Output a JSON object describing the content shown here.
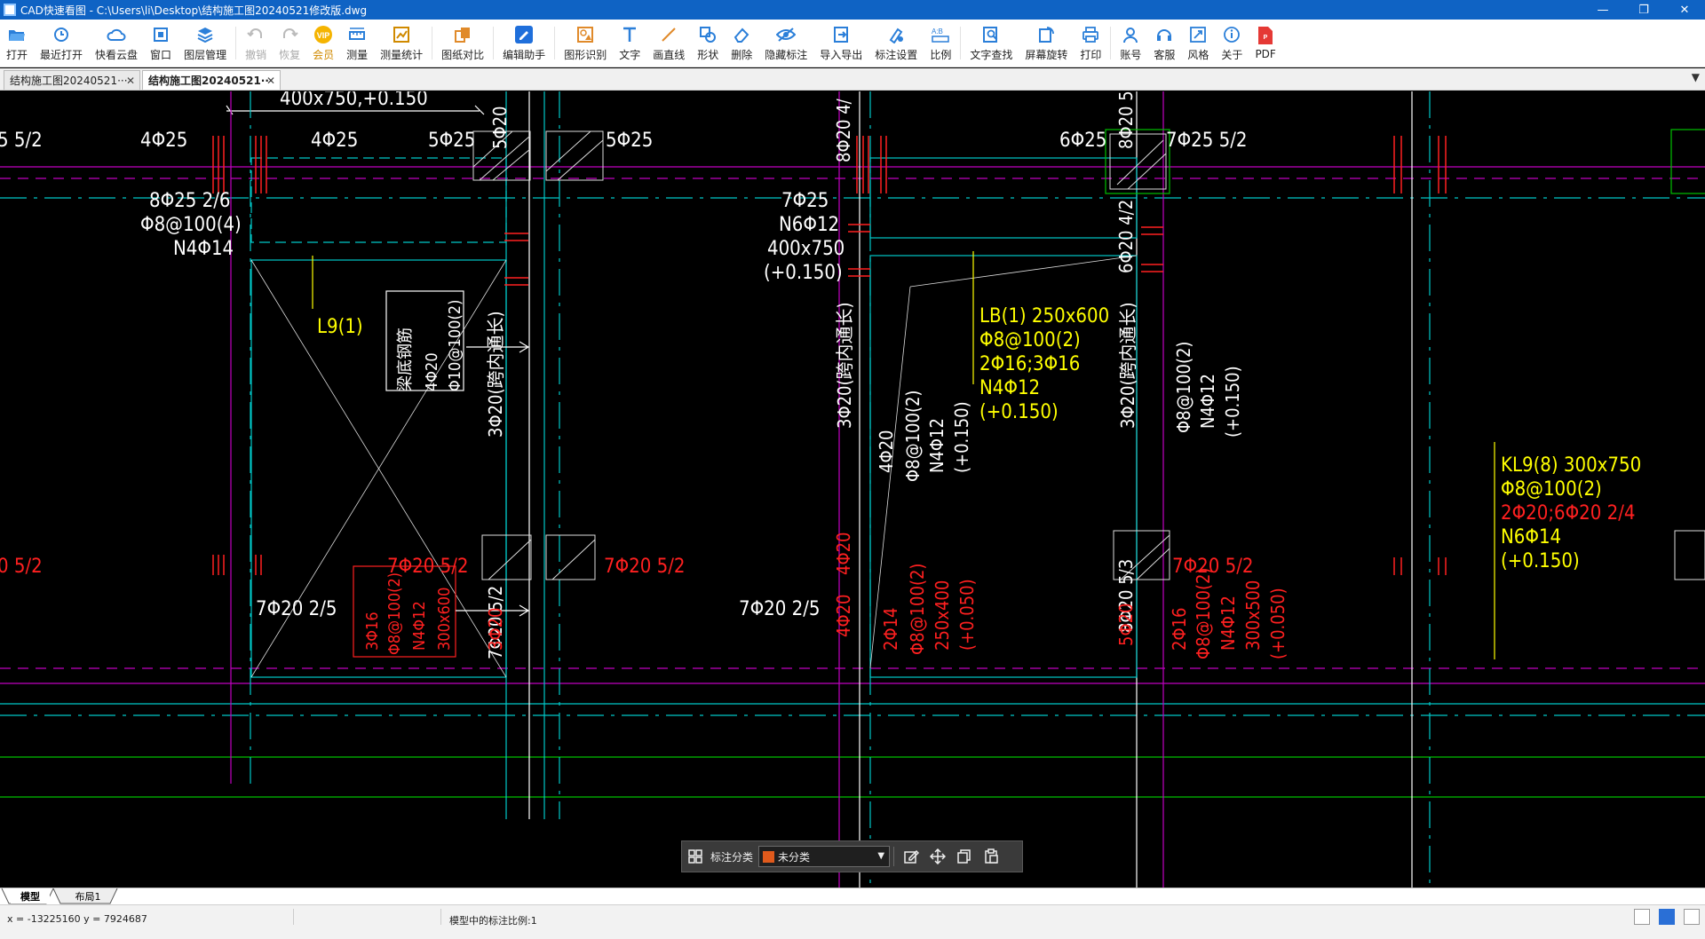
{
  "window": {
    "title": "CAD快速看图 - C:\\Users\\li\\Desktop\\结构施工图20240521修改版.dwg",
    "controls": [
      "—",
      "❐",
      "✕"
    ]
  },
  "toolbar": {
    "items": [
      {
        "label": "打开",
        "icon": "folder-open-icon"
      },
      {
        "label": "最近打开",
        "icon": "history-icon"
      },
      {
        "label": "快看云盘",
        "icon": "cloud-icon"
      },
      {
        "label": "窗口",
        "icon": "window-icon"
      },
      {
        "label": "图层管理",
        "icon": "layers-icon"
      },
      {
        "label": "撤销",
        "icon": "undo-icon",
        "disabled": true
      },
      {
        "label": "恢复",
        "icon": "redo-icon",
        "disabled": true
      },
      {
        "label": "会员",
        "icon": "vip-icon"
      },
      {
        "label": "测量",
        "icon": "measure-icon"
      },
      {
        "label": "测量统计",
        "icon": "measure-stats-icon"
      },
      {
        "label": "图纸对比",
        "icon": "compare-icon"
      },
      {
        "label": "编辑助手",
        "icon": "edit-assistant-icon"
      },
      {
        "label": "图形识别",
        "icon": "shape-recognize-icon"
      },
      {
        "label": "文字",
        "icon": "text-icon"
      },
      {
        "label": "画直线",
        "icon": "line-icon"
      },
      {
        "label": "形状",
        "icon": "shape-icon"
      },
      {
        "label": "删除",
        "icon": "eraser-icon"
      },
      {
        "label": "隐藏标注",
        "icon": "hide-annotation-icon"
      },
      {
        "label": "导入导出",
        "icon": "import-export-icon"
      },
      {
        "label": "标注设置",
        "icon": "annotation-settings-icon"
      },
      {
        "label": "比例",
        "icon": "scale-icon"
      },
      {
        "label": "文字查找",
        "icon": "text-search-icon"
      },
      {
        "label": "屏幕旋转",
        "icon": "rotate-screen-icon"
      },
      {
        "label": "打印",
        "icon": "print-icon"
      },
      {
        "label": "账号",
        "icon": "account-icon"
      },
      {
        "label": "客服",
        "icon": "support-icon"
      },
      {
        "label": "风格",
        "icon": "style-icon"
      },
      {
        "label": "关于",
        "icon": "info-icon"
      },
      {
        "label": "PDF",
        "icon": "pdf-icon"
      }
    ]
  },
  "tabs": [
    {
      "label": "结构施工图20240521···",
      "close": "✕",
      "active": false
    },
    {
      "label": "结构施工图20240521···",
      "close": "✕",
      "active": true
    }
  ],
  "tab_dropdown": "▼",
  "drawing": {
    "texts": {
      "t1": "400x750,+0.150",
      "t2": "5Φ20",
      "t3": "5 5/2",
      "t4": "4Φ25",
      "t5": "4Φ25",
      "t6": "5Φ25",
      "t7": "5Φ25",
      "t8": "8Φ20 4/",
      "t9": "6Φ25",
      "t10": "7Φ25 5/2",
      "t11": "8Φ20 5",
      "t12": "8Φ25 2/6",
      "t13": "Φ8@100(4)",
      "t14": "N4Φ14",
      "t15": "7Φ25",
      "t16": "N6Φ12",
      "t17": "400x750",
      "t18": "(+0.150)",
      "t19": "6Φ20 4/2",
      "t20": "L9(1)",
      "t21": "梁底钢筋",
      "t22": "4Φ20",
      "t23": "Φ10@100(2)",
      "t24": "3Φ20(跨内通长)",
      "t25": "3Φ20(跨内通长)",
      "t26": "LB(1) 250x600",
      "t27": "Φ8@100(2)",
      "t28": "2Φ16;3Φ16",
      "t29": "N4Φ12",
      "t30": "(+0.150)",
      "t31": "4Φ20",
      "t32": "Φ8@100(2)",
      "t33": "N4Φ12",
      "t34": "(+0.150)",
      "t35": "3Φ20(跨内通长)",
      "t36": "Φ8@100(2)",
      "t37": "N4Φ12",
      "t38": "(+0.150)",
      "t39": "7Φ20 5/2",
      "t40": "8Φ20 5/3",
      "t41": "KL9(8) 300x750",
      "t42": "Φ8@100(2)",
      "t43": "2Φ20;6Φ20 2/4",
      "t44": "N6Φ14",
      "t45": "(+0.150)",
      "t46": "0 5/2",
      "t47": "7Φ20 5/2",
      "t48": "7Φ20 5/2",
      "t49": "4Φ20",
      "t50": "7Φ20 5/2",
      "t51": "7Φ20 2/5",
      "t52": "7Φ20 2/5",
      "t53": "3Φ16",
      "t54": "Φ8@100(2)",
      "t55": "N4Φ12",
      "t56": "300x600",
      "t57": "3Φ20",
      "t58": "4Φ20",
      "t59": "2Φ14",
      "t60": "Φ8@100(2)",
      "t61": "250x400",
      "t62": "(+0.050)",
      "t63": "5Φ20",
      "t64": "2Φ16",
      "t65": "Φ8@100(2)",
      "t66": "N4Φ12",
      "t67": "300x500",
      "t68": "(+0.050)"
    }
  },
  "annotation_bar": {
    "label": "标注分类",
    "selected": "未分类",
    "swatch_color": "#e05a1c"
  },
  "layout_tabs": [
    "模型",
    "布局1"
  ],
  "status": {
    "coords": "x = -13225160  y = 7924687",
    "scale": "模型中的标注比例:1"
  },
  "colors": {
    "title_bar": "#0f63c4",
    "cad_yellow": "#ffff00",
    "cad_red": "#ff2020",
    "cad_white": "#ffffff",
    "cad_cyan": "#00c8c8",
    "cad_green": "#00c000",
    "cad_magenta": "#c000c0"
  }
}
